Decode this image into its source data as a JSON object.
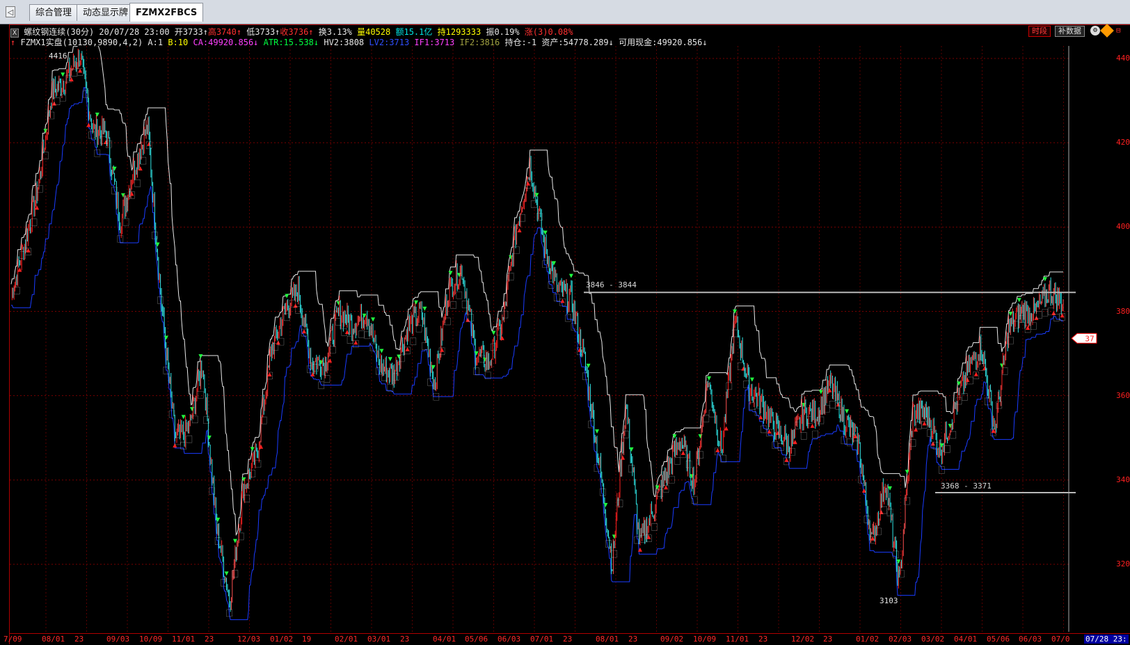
{
  "tabs": [
    "综合管理",
    "动态显示牌",
    "FZMX2FBCS"
  ],
  "tab_scroll": "◁",
  "info_line1": {
    "close_btn": "X",
    "symbol": "螺纹钢连续(30分)",
    "datetime": "20/07/28 23:00",
    "open": "开3733↑",
    "high": "高3740↑",
    "low": "低3733↑",
    "close": "收3736↑",
    "turnover": "换3.13%",
    "volume": "量40528",
    "amount": "额15.1亿",
    "position": "持1293333",
    "amplitude": "振0.19%",
    "change": "涨(3)0.08%"
  },
  "info_line2": {
    "arrow": "↑",
    "model": "FZMX1实盘(10130,9890,4,2)",
    "a": "A:1",
    "b": "B:10",
    "ca": "CA:49920.856↓",
    "atr": "ATR:15.538↓",
    "hv2": "HV2:3808",
    "lv2": "LV2:3713",
    "if1": "IF1:3713",
    "if2": "IF2:3816",
    "hold": "持仓:-1",
    "assets": "资产:54778.289↓",
    "cash": "可用现金:49920.856↓"
  },
  "toolbar": {
    "time_btn": "时段",
    "fill_btn": "补数据",
    "gear_icon": "gear-icon",
    "warning_icon": "warning-icon"
  },
  "annotations": {
    "high_label": "4416",
    "low_label": "3103",
    "zone_upper": "3846 - 3844",
    "zone_lower": "3368 - 3371",
    "current_price": "37"
  },
  "y_axis_labels": [
    "440",
    "420",
    "400",
    "380",
    "360",
    "340",
    "320"
  ],
  "x_axis_labels": [
    "7/09",
    "08/01",
    "23",
    "09/03",
    "10/09",
    "11/01",
    "23",
    "12/03",
    "01/02",
    "19",
    "02/01",
    "03/01",
    "23",
    "04/01",
    "05/06",
    "06/03",
    "07/01",
    "23",
    "08/01",
    "23",
    "09/02",
    "10/09",
    "11/01",
    "23",
    "12/02",
    "23",
    "01/02",
    "02/03",
    "03/02",
    "04/01",
    "05/06",
    "06/03",
    "07/0",
    "07/28 23:"
  ],
  "chart_data": {
    "type": "line",
    "title": "螺纹钢连续(30分)",
    "xlabel": "",
    "ylabel": "",
    "ylim": [
      3100,
      4450
    ],
    "series": [
      {
        "name": "",
        "values": [
          3840,
          3960,
          4100,
          4320,
          4350,
          4410,
          4230,
          4220,
          4010,
          4140,
          4240,
          3820,
          3500,
          3520,
          3680,
          3300,
          3110,
          3380,
          3460,
          3700,
          3800,
          3850,
          3680,
          3680,
          3800,
          3770,
          3800,
          3670,
          3650,
          3760,
          3800,
          3630,
          3850,
          3900,
          3700,
          3680,
          3780,
          4000,
          4150,
          3960,
          3850,
          3830,
          3680,
          3450,
          3200,
          3580,
          3250,
          3330,
          3420,
          3500,
          3390,
          3640,
          3470,
          3780,
          3620,
          3580,
          3520,
          3480,
          3560,
          3560,
          3630,
          3540,
          3490,
          3250,
          3400,
          3150,
          3560,
          3560,
          3470,
          3560,
          3660,
          3720,
          3520,
          3760,
          3800,
          3800,
          3850,
          3820
        ]
      }
    ],
    "horizontal_levels": [
      3845,
      3370
    ],
    "annotations": [
      "4416",
      "3103",
      "3846 - 3844",
      "3368 - 3371"
    ]
  }
}
